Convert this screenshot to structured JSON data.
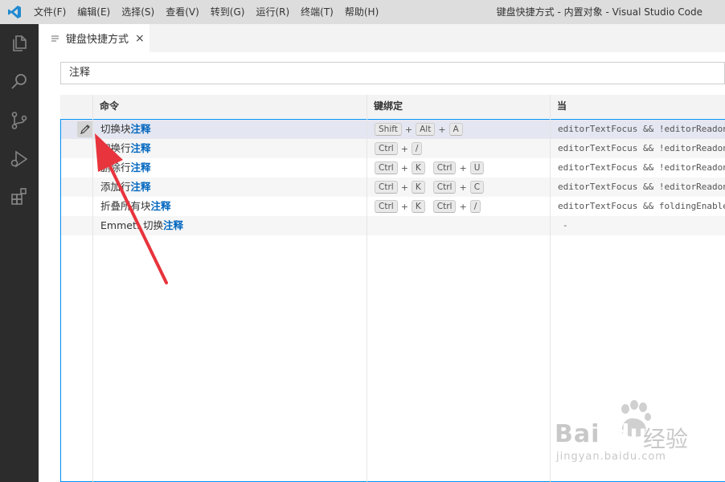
{
  "menubar": {
    "items": [
      "文件(F)",
      "编辑(E)",
      "选择(S)",
      "查看(V)",
      "转到(G)",
      "运行(R)",
      "终端(T)",
      "帮助(H)"
    ],
    "window_title": "键盘快捷方式 - 内置对象 - Visual Studio Code"
  },
  "activitybar": {
    "icons": [
      "explorer-icon",
      "search-icon",
      "source-control-icon",
      "run-debug-icon",
      "extensions-icon"
    ]
  },
  "tab": {
    "label": "键盘快捷方式",
    "close": "×"
  },
  "search": {
    "value": "注释"
  },
  "table": {
    "headers": {
      "command": "命令",
      "keybinding": "键绑定",
      "when": "当"
    },
    "rows": [
      {
        "cmd_prefix": "切换块",
        "cmd_match": "注释",
        "chords": [
          [
            "Shift",
            "Alt",
            "A"
          ]
        ],
        "when": "editorTextFocus && !editorReadonly"
      },
      {
        "cmd_prefix": "切换行",
        "cmd_match": "注释",
        "chords": [
          [
            "Ctrl",
            "/"
          ]
        ],
        "when": "editorTextFocus && !editorReadonly"
      },
      {
        "cmd_prefix": "删除行",
        "cmd_match": "注释",
        "chords": [
          [
            "Ctrl",
            "K"
          ],
          [
            "Ctrl",
            "U"
          ]
        ],
        "when": "editorTextFocus && !editorReadonly"
      },
      {
        "cmd_prefix": "添加行",
        "cmd_match": "注释",
        "chords": [
          [
            "Ctrl",
            "K"
          ],
          [
            "Ctrl",
            "C"
          ]
        ],
        "when": "editorTextFocus && !editorReadonly"
      },
      {
        "cmd_prefix": "折叠所有块",
        "cmd_match": "注释",
        "chords": [
          [
            "Ctrl",
            "K"
          ],
          [
            "Ctrl",
            "/"
          ]
        ],
        "when": "editorTextFocus && foldingEnabled"
      },
      {
        "cmd_prefix": "Emmet: 切换",
        "cmd_match": "注释",
        "chords": [],
        "when": "-"
      }
    ]
  },
  "watermark": {
    "logo_text": "Bai",
    "logo_text2": "du",
    "cn_text": "经验",
    "url": "jingyan.baidu.com"
  },
  "colors": {
    "activitybar": "#2c2c2c",
    "highlight": "#0066bf",
    "focus_border": "#0090f1",
    "arrow": "#e8343c"
  }
}
